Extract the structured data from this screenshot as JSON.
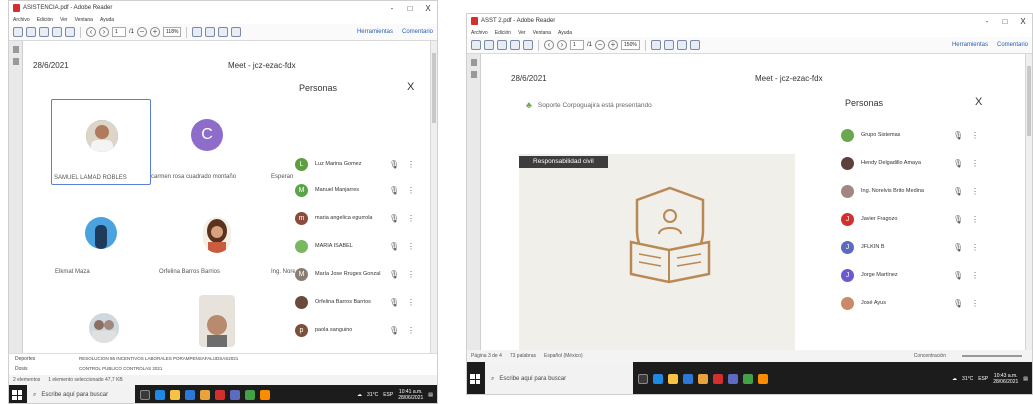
{
  "left": {
    "title": "ASISTENCIA.pdf - Adobe Reader",
    "window": {
      "minimize": "-",
      "maximize": "□",
      "close": "X"
    },
    "menu": [
      "Archivo",
      "Edición",
      "Ver",
      "Ventana",
      "Ayuda"
    ],
    "toolbar": {
      "page": "1",
      "total": "/1",
      "zoom": "118%",
      "tools": "Herramientas",
      "comment": "Comentario"
    },
    "meet": {
      "date": "28/6/2021",
      "code": "Meet - jcz-ezac-fdx"
    },
    "tiles": [
      {
        "name": "SAMUEL LAMAD ROBLES"
      },
      {
        "name": "carmen rosa cuadrado montaño",
        "initial": "C"
      },
      {
        "name": "Esperan"
      },
      {
        "name": "Elkmat Maza"
      },
      {
        "name": "Orfelina Barros Barrios"
      },
      {
        "name": "Ing. Nore"
      }
    ],
    "people": {
      "title": "Personas",
      "close": "X",
      "list": [
        {
          "name": "Luz Marina Gomez",
          "initial": "L",
          "color": "#5f9e3f"
        },
        {
          "name": "Manuel Manjarres",
          "initial": "M",
          "color": "#5aa54b"
        },
        {
          "name": "maria angelica egurrola",
          "initial": "m",
          "color": "#8b4a3b"
        },
        {
          "name": "MARIA ISABEL",
          "initial": "",
          "color": "#7bb661"
        },
        {
          "name": "María Jose Rruges Gonzal...",
          "initial": "M",
          "color": "#8a7d72"
        },
        {
          "name": "Orfelina Barros Barrios",
          "initial": "",
          "color": "#6b4a3a"
        },
        {
          "name": "paola sanguino",
          "initial": "p",
          "color": "#7c4f3a"
        }
      ]
    },
    "status": {
      "items": "2 elementos",
      "selected": "1 elemento seleccionado 47,7 KB"
    },
    "files": [
      "RESOLUCION 86 INCENTIVOS LABORALES PORAMPENSAFALUDSAS2021",
      "CONTROL PUBLICO CONTROLAS 2021"
    ],
    "explorer": [
      "Deportes",
      "Dosis"
    ],
    "taskbar": {
      "search": "Escribe aquí para buscar",
      "temp": "31°C",
      "lang": "ESP",
      "time": "10:41 a.m.",
      "date": "28/06/2021"
    }
  },
  "right": {
    "title": "ASST 2.pdf - Adobe Reader",
    "window": {
      "minimize": "-",
      "maximize": "□",
      "close": "X"
    },
    "menu": [
      "Archivo",
      "Edición",
      "Ver",
      "Ventana",
      "Ayuda"
    ],
    "toolbar": {
      "page": "1",
      "total": "/1",
      "zoom": "150%",
      "tools": "Herramientas",
      "comment": "Comentario"
    },
    "meet": {
      "date": "28/6/2021",
      "code": "Meet - jcz-ezac-fdx"
    },
    "presenting": "Soporte Corpoguajira está presentando",
    "slide_title": "Responsabilidad civil",
    "people": {
      "title": "Personas",
      "close": "X",
      "list": [
        {
          "name": "Grupo Sistemas",
          "initial": "",
          "color": "#6aa84f"
        },
        {
          "name": "Hendy Delgadillo Amaya",
          "initial": "",
          "color": "#5d4037"
        },
        {
          "name": "Ing. Norelvis Brito Medina",
          "initial": "",
          "color": "#a1887f"
        },
        {
          "name": "Javier Fragozo",
          "initial": "J",
          "color": "#d32f2f"
        },
        {
          "name": "JFLKIN B",
          "initial": "J",
          "color": "#5c6bc0"
        },
        {
          "name": "Jorge Martínez",
          "initial": "J",
          "color": "#6a5acd"
        },
        {
          "name": "José Ayus",
          "initial": "",
          "color": "#c58b6b"
        }
      ]
    },
    "status": {
      "page": "Página 3 de 4",
      "words": "73 palabras",
      "lang": "Español (México)",
      "focus": "Concentración"
    },
    "taskbar": {
      "search": "Escribe aquí para buscar",
      "temp": "31°C",
      "lang": "ESP",
      "time": "10:43 a.m.",
      "date": "28/06/2021"
    }
  }
}
